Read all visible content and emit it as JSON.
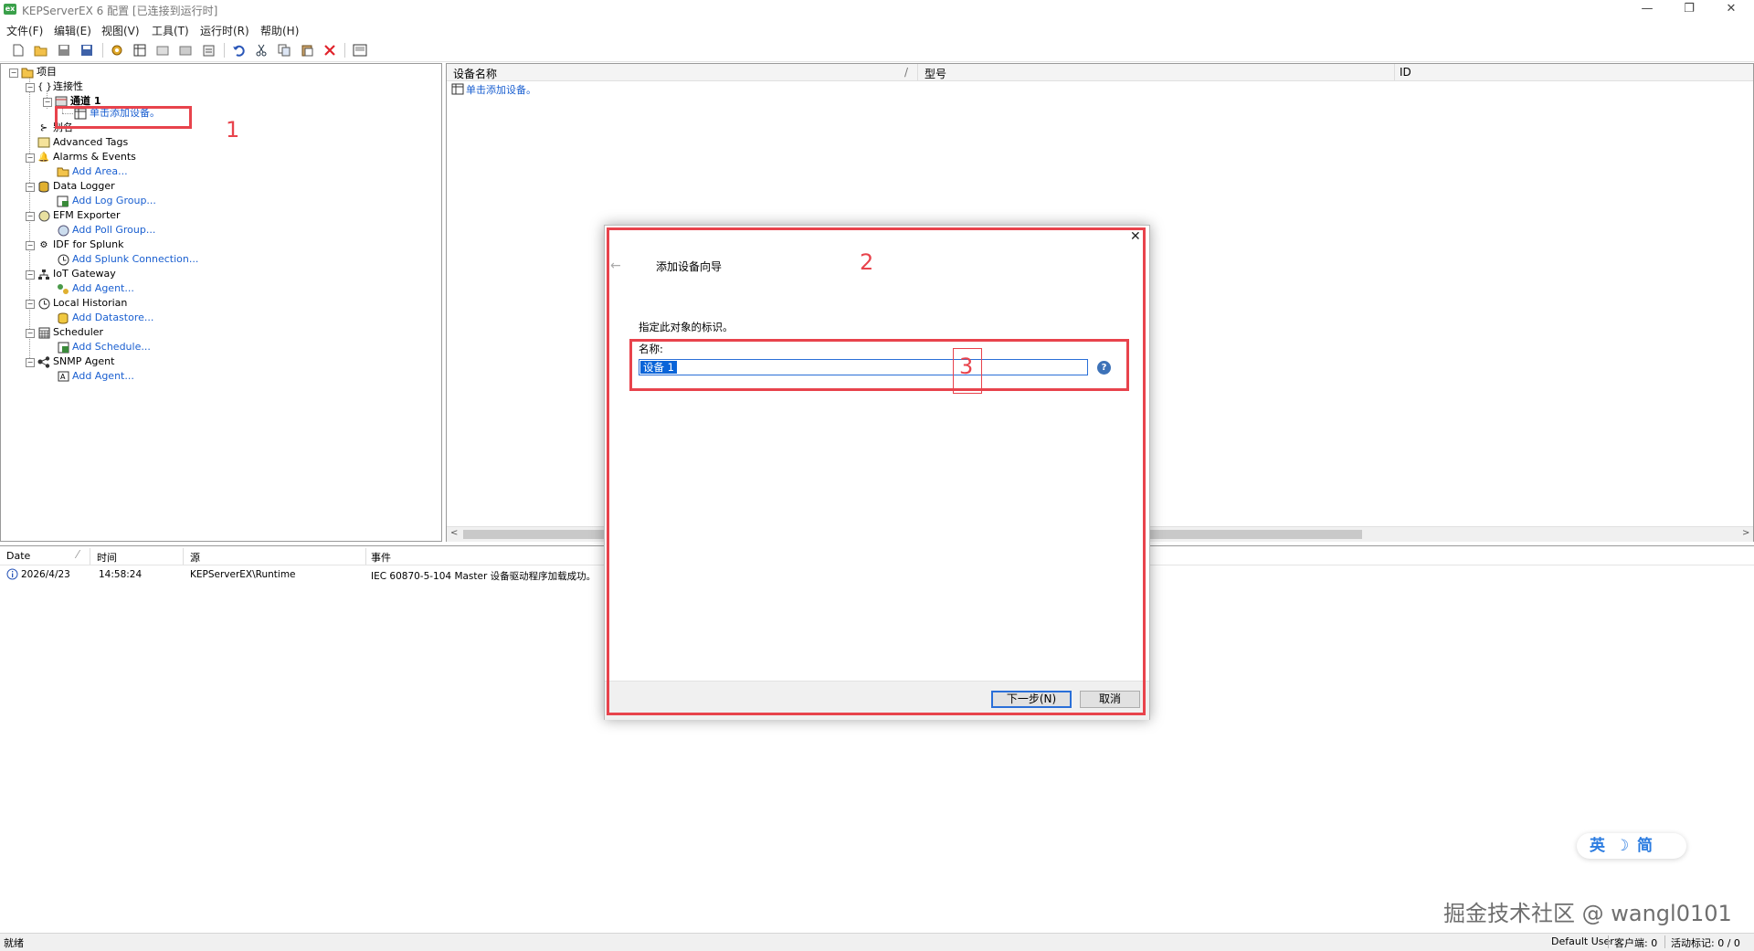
{
  "window": {
    "title": "KEPServerEX 6 配置 [已连接到运行时]",
    "app_icon_text": "ex",
    "minimize": "—",
    "restore": "❐",
    "close": "✕"
  },
  "menu": [
    "文件(F)",
    "编辑(E)",
    "视图(V)",
    "工具(T)",
    "运行时(R)",
    "帮助(H)"
  ],
  "tree": {
    "root": "项目",
    "connectivity": "连接性",
    "channel": "通道 1",
    "add_device": "单击添加设备。",
    "alias": "别名",
    "advanced_tags": "Advanced Tags",
    "alarms": "Alarms & Events",
    "add_area": "Add Area...",
    "data_logger": "Data Logger",
    "add_log_group": "Add Log Group...",
    "efm": "EFM Exporter",
    "add_poll_group": "Add Poll Group...",
    "idf": "IDF for Splunk",
    "add_splunk": "Add Splunk Connection...",
    "iot": "IoT Gateway",
    "add_agent": "Add Agent...",
    "historian": "Local Historian",
    "add_datastore": "Add Datastore...",
    "scheduler": "Scheduler",
    "add_schedule": "Add Schedule...",
    "snmp": "SNMP Agent",
    "add_snmp_agent": "Add Agent..."
  },
  "detail": {
    "col_name": "设备名称",
    "col_sort": "/",
    "col_model": "型号",
    "col_id": "ID",
    "add_device": "单击添加设备。"
  },
  "log": {
    "headers": [
      "Date",
      "时间",
      "源",
      "事件"
    ],
    "rows": [
      {
        "date": "2026/4/23",
        "time": "14:58:24",
        "source": "KEPServerEX\\Runtime",
        "event": "IEC 60870-5-104 Master 设备驱动程序加载成功。"
      }
    ]
  },
  "dialog": {
    "title": "添加设备向导",
    "instruction": "指定此对象的标识。",
    "name_label": "名称:",
    "name_value": "设备 1",
    "help": "?",
    "next": "下一步(N)",
    "cancel": "取消",
    "close": "✕",
    "back": "←"
  },
  "annotations": [
    "1",
    "2",
    "3"
  ],
  "ime": {
    "lang": "英",
    "moon": "☽",
    "mode": "简"
  },
  "watermark": "掘金技术社区 @ wangl0101",
  "status": {
    "left": "就绪",
    "user": "Default User",
    "clients": "客户端: 0",
    "active_tags": "活动标记: 0 / 0"
  },
  "colors": {
    "annotation_red": "#e8434c",
    "link_blue": "#1a5fd0",
    "selection_blue": "#0a64d8"
  }
}
